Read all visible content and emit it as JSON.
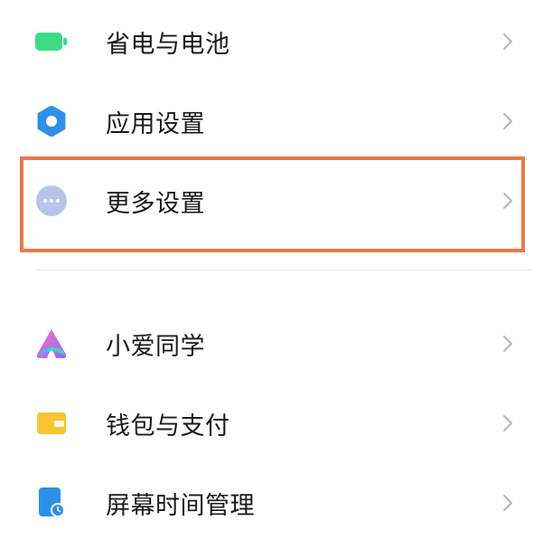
{
  "settings": {
    "items": [
      {
        "label": "省电与电池",
        "icon": "battery-icon"
      },
      {
        "label": "应用设置",
        "icon": "gear-icon"
      },
      {
        "label": "更多设置",
        "icon": "more-dots-icon"
      },
      {
        "label": "小爱同学",
        "icon": "xiaoai-icon"
      },
      {
        "label": "钱包与支付",
        "icon": "wallet-icon"
      },
      {
        "label": "屏幕时间管理",
        "icon": "screen-time-icon"
      }
    ]
  },
  "colors": {
    "battery_green": "#3ddc84",
    "gear_blue": "#2f8fe8",
    "more_dots_bg": "#b8c4ec",
    "wallet_yellow": "#f7c531",
    "screen_time_blue": "#2f8fe8",
    "highlight_border": "#e87a4c",
    "chevron_gray": "#b5b5b5"
  }
}
